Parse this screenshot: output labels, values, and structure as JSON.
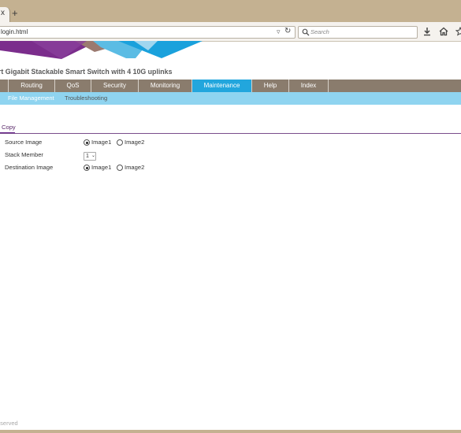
{
  "browser": {
    "tab_close_glyph": "x",
    "new_tab_glyph": "+",
    "url": "login.html",
    "search_placeholder": "Search",
    "url_dropdown_glyph": "▿",
    "reload_glyph": "↻"
  },
  "header": {
    "product_title": "rt Gigabit Stackable Smart Switch with 4 10G uplinks"
  },
  "main_nav": {
    "tabs": [
      {
        "label": "Routing",
        "active": false
      },
      {
        "label": "QoS",
        "active": false
      },
      {
        "label": "Security",
        "active": false
      },
      {
        "label": "Monitoring",
        "active": false
      },
      {
        "label": "Maintenance",
        "active": true
      },
      {
        "label": "Help",
        "active": false
      },
      {
        "label": "Index",
        "active": false
      }
    ],
    "active_color": "#22a6dd"
  },
  "sub_nav": {
    "items": [
      {
        "label": "File Management",
        "active": true
      },
      {
        "label": "Troubleshooting",
        "active": false
      }
    ]
  },
  "page": {
    "tab_label": "Copy",
    "form": {
      "source_image": {
        "label": "Source Image",
        "options": [
          {
            "label": "Image1",
            "selected": true
          },
          {
            "label": "Image2",
            "selected": false
          }
        ]
      },
      "stack_member": {
        "label": "Stack Member",
        "value": "1"
      },
      "destination_image": {
        "label": "Destination Image",
        "options": [
          {
            "label": "Image1",
            "selected": true
          },
          {
            "label": "Image2",
            "selected": false
          }
        ]
      }
    }
  },
  "footer": {
    "text": "eserved"
  }
}
